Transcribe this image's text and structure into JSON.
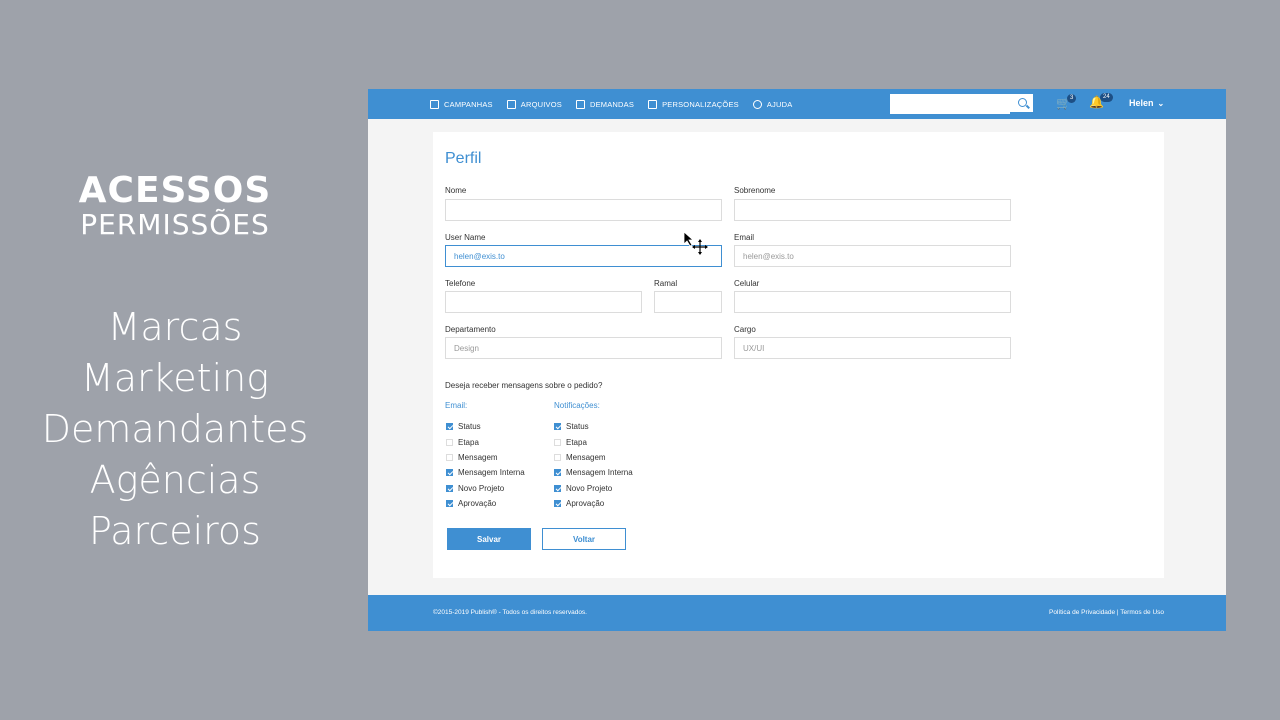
{
  "slide": {
    "heading_main": "ACESSOS",
    "heading_sub": "PERMISSÕES",
    "roles": [
      "Marcas",
      "Marketing",
      "Demandantes",
      "Agências",
      "Parceiros"
    ]
  },
  "topbar": {
    "nav": [
      {
        "label": "CAMPANHAS",
        "icon": "calendar-icon"
      },
      {
        "label": "ARQUIVOS",
        "icon": "file-icon"
      },
      {
        "label": "DEMANDAS",
        "icon": "list-icon"
      },
      {
        "label": "PERSONALIZAÇÕES",
        "icon": "edit-icon"
      },
      {
        "label": "AJUDA",
        "icon": "help-icon"
      }
    ],
    "search_placeholder": "",
    "cart_count": "3",
    "notifications_count": "24",
    "user_name": "Helen"
  },
  "form": {
    "title": "Perfil",
    "fields": {
      "nome": {
        "label": "Nome",
        "value": ""
      },
      "sobrenome": {
        "label": "Sobrenome",
        "value": ""
      },
      "username": {
        "label": "User Name",
        "value": "helen@exis.to"
      },
      "email": {
        "label": "Email",
        "value": "helen@exis.to"
      },
      "telefone": {
        "label": "Telefone",
        "value": ""
      },
      "ramal": {
        "label": "Ramal",
        "value": ""
      },
      "celular": {
        "label": "Celular",
        "value": ""
      },
      "departamento": {
        "label": "Departamento",
        "value": "Design"
      },
      "cargo": {
        "label": "Cargo",
        "value": "UX/UI"
      }
    },
    "question": "Deseja receber mensagens sobre o pedido?",
    "email_col_title": "Email:",
    "notif_col_title": "Notificações:",
    "email_options": [
      {
        "label": "Status",
        "checked": true
      },
      {
        "label": "Etapa",
        "checked": false
      },
      {
        "label": "Mensagem",
        "checked": false
      },
      {
        "label": "Mensagem Interna",
        "checked": true
      },
      {
        "label": "Novo Projeto",
        "checked": true
      },
      {
        "label": "Aprovação",
        "checked": true
      }
    ],
    "notif_options": [
      {
        "label": "Status",
        "checked": true
      },
      {
        "label": "Etapa",
        "checked": false
      },
      {
        "label": "Mensagem",
        "checked": false
      },
      {
        "label": "Mensagem Interna",
        "checked": true
      },
      {
        "label": "Novo Projeto",
        "checked": true
      },
      {
        "label": "Aprovação",
        "checked": true
      }
    ],
    "save_label": "Salvar",
    "back_label": "Voltar"
  },
  "footer": {
    "copyright": "©2015-2019 Publish® - Todos os direitos reservados.",
    "links": "Política de Privacidade | Termos de Uso"
  },
  "colors": {
    "brand": "#3f8fd2",
    "background": "#9ea2aa"
  }
}
